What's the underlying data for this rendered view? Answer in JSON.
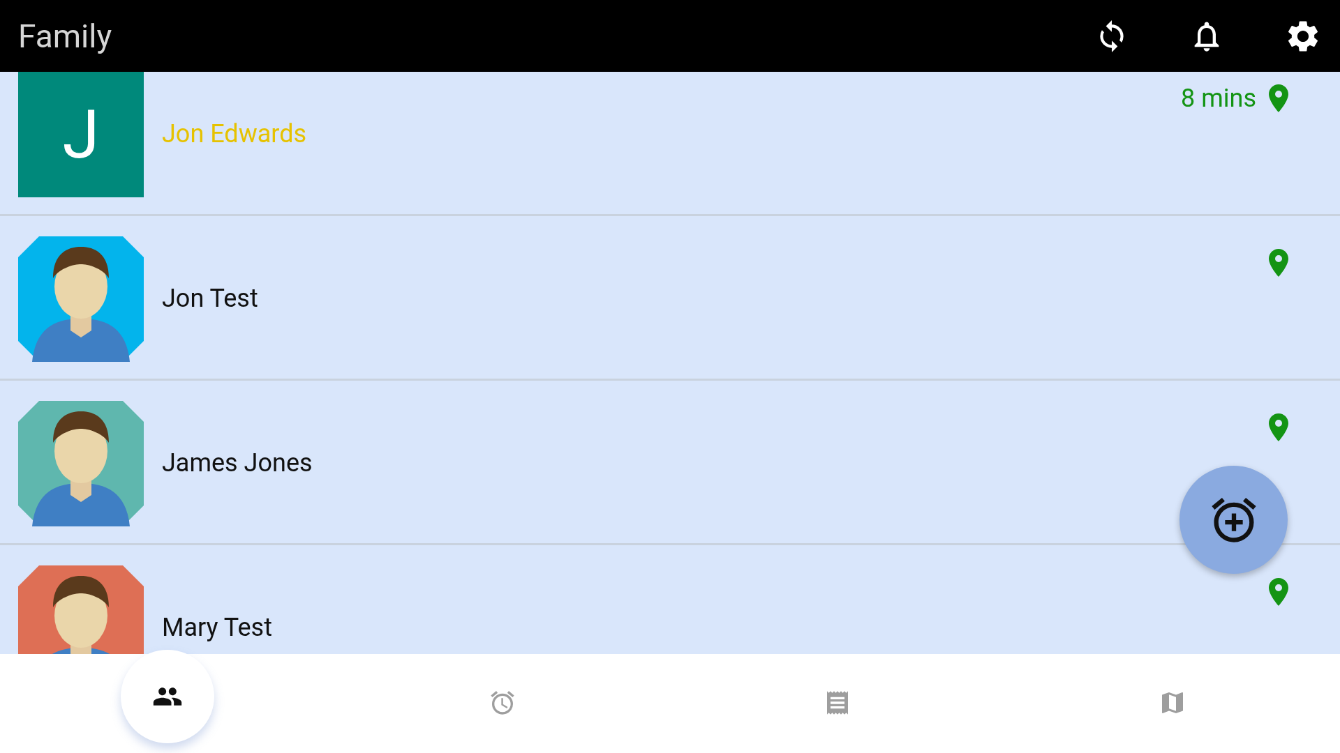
{
  "header": {
    "title": "Family"
  },
  "members": [
    {
      "name": "Jon Edwards",
      "color": "#e6c200",
      "time": "8 mins",
      "avatar": {
        "kind": "letter",
        "letter": "J",
        "color": "#00897b"
      }
    },
    {
      "name": "Jon Test",
      "color": "#111111"
    },
    {
      "name": "James Jones",
      "color": "#111111"
    },
    {
      "name": "Mary Test",
      "color": "#111111"
    }
  ],
  "nav": [
    {
      "kind": "people",
      "selected": true
    },
    {
      "kind": "alarm",
      "selected": false
    },
    {
      "kind": "list",
      "selected": false
    },
    {
      "kind": "map",
      "selected": false
    }
  ]
}
